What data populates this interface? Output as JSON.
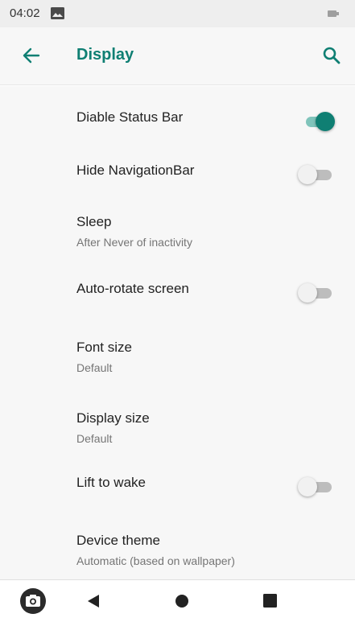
{
  "status_bar": {
    "time": "04:02",
    "icons": [
      "image-notification-icon",
      "battery-icon"
    ]
  },
  "app_bar": {
    "title": "Display",
    "icons": [
      "back-arrow-icon",
      "search-icon"
    ],
    "accent_color": "#0f7f73"
  },
  "settings": [
    {
      "title": "Diable Status Bar",
      "type": "toggle",
      "checked": true
    },
    {
      "title": "Hide NavigationBar",
      "type": "toggle",
      "checked": false
    },
    {
      "title": "Sleep",
      "summary": "After Never of inactivity",
      "type": "item"
    },
    {
      "title": "Auto-rotate screen",
      "type": "toggle",
      "checked": false
    },
    {
      "title": "Font size",
      "summary": "Default",
      "type": "item"
    },
    {
      "title": "Display size",
      "summary": "Default",
      "type": "item"
    },
    {
      "title": "Lift to wake",
      "type": "toggle",
      "checked": false
    },
    {
      "title": "Device theme",
      "summary": "Automatic (based on wallpaper)",
      "type": "item"
    }
  ],
  "nav_bar": {
    "icons": [
      "camera-icon",
      "back-triangle-icon",
      "home-circle-icon",
      "recents-square-icon"
    ]
  }
}
